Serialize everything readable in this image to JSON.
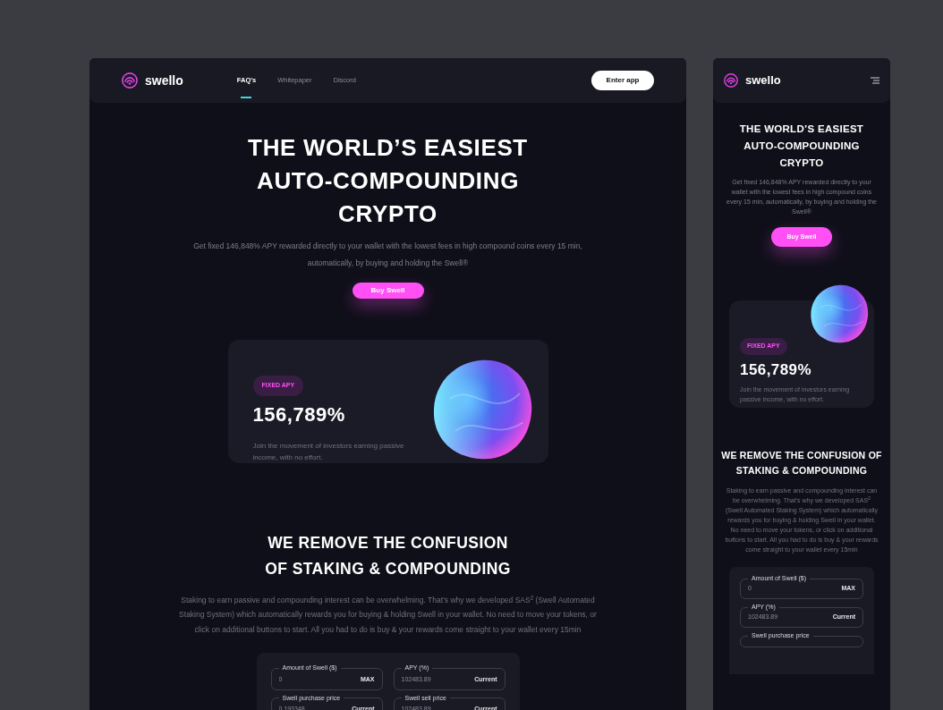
{
  "screens": [
    {
      "kind": "desktop",
      "nav": {
        "logo": "swello",
        "links": [
          {
            "label": "FAQ's",
            "selected": true
          },
          {
            "label": "Whitepaper",
            "selected": false
          },
          {
            "label": "Discord",
            "selected": false
          }
        ],
        "button": "Enter app"
      },
      "hero": {
        "title": "THE WORLD’S EASIEST AUTO-COMPOUNDING CRYPTO",
        "text": "Get fixed 146,848% APY rewarded directly to your wallet with the lowest fees in high compound coins every 15 min, automatically, by buying and holding the Swell®",
        "button": "Buy Swell"
      },
      "apy_card": {
        "badge": "FIXED APY",
        "value": "156,789%",
        "text": "Join the movement of investors earning passive income, with no effort."
      },
      "section": {
        "title": "WE REMOVE THE CONFUSION OF STAKING & COMPOUNDING",
        "text": "Staking to earn passive and compounding interest can be overwhelming. That’s why we developed SAS$^{2}$ (Swell Automated Staking System) which automatically rewards you for buying & holding Swell in your wallet. No need to move your tokens, or click on additional buttons to start. All you had to do is buy & your rewards come straight to your wallet every 15min"
      },
      "calculator": {
        "fields": [
          {
            "label": "Amount of Swell ($)",
            "value": "0",
            "action": "MAX"
          },
          {
            "label": "APY (%)",
            "value": "102483.89",
            "action": "Current"
          },
          {
            "label": "Swell purchase price",
            "value": "0.193348",
            "action": "Current"
          },
          {
            "label": "Swell sell price",
            "value": "102483.89",
            "action": "Current"
          }
        ]
      }
    },
    {
      "kind": "mobile",
      "nav": {
        "logo": "swello"
      },
      "hero": {
        "title": "THE WORLD’S EASIEST AUTO-COMPOUNDING CRYPTO",
        "text": "Get fixed 146,848% APY rewarded directly to your wallet with the lowest fees in high compound coins every 15 min, automatically, by buying and holding the Swell®",
        "button": "Buy Swell"
      },
      "apy_card": {
        "badge": "FIXED APY",
        "value": "156,789%",
        "text": "Join the movement of investors earning passive income, with no effort."
      },
      "section": {
        "title": "WE REMOVE THE CONFUSION OF STAKING & COMPOUNDING",
        "text": "Staking to earn passive and compounding interest can be overwhelming. That’s why we developed SAS$^{2}$ (Swell Automated Staking System) which automatically rewards you for buying & holding Swell in your wallet. No need to move your tokens, or click on additional buttons to start. All you had to do is buy & your rewards come straight to your wallet every 15min"
      },
      "calculator": {
        "fields": [
          {
            "label": "Amount of Swell ($)",
            "value": "0",
            "action": "MAX"
          },
          {
            "label": "APY (%)",
            "value": "102483.89",
            "action": "Current"
          },
          {
            "label": "Swell purchase price"
          }
        ]
      }
    }
  ]
}
